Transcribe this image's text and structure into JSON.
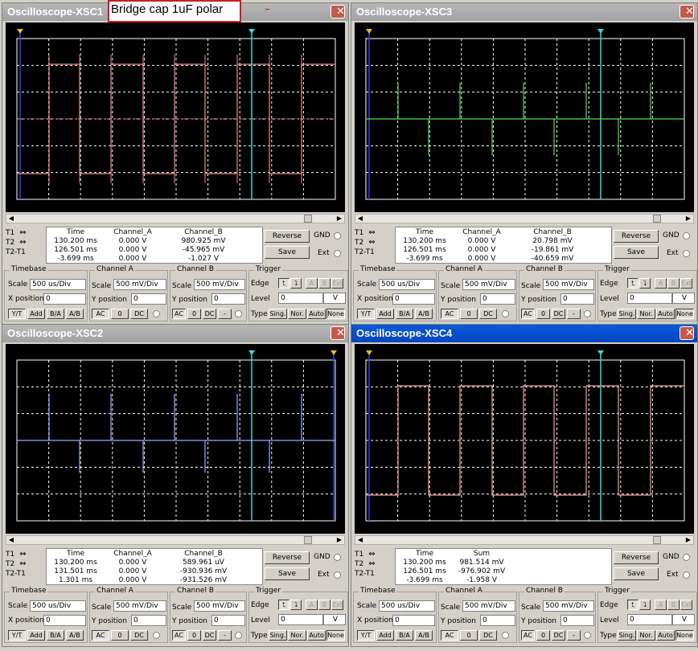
{
  "annotation": "Bridge cap 1uF polar",
  "colors": {
    "ch_a_xsc1": "#f08a8a",
    "ch_a_xsc3": "#4ee04e",
    "ch_a_xsc2": "#9aa8ff",
    "ch_a_xsc4": "#f0a0a0",
    "cursor1": "#3a3ad8",
    "cursor2": "#38d8d8",
    "grid": "#ffffff",
    "titlebar_active": "#0a50d0"
  },
  "icons": {
    "close": "close-icon",
    "cursor_marker": "triangle-marker-icon",
    "radio": "radio-icon",
    "edge_rise": "rising-edge-icon",
    "edge_fall": "falling-edge-icon"
  },
  "scopes": [
    {
      "title": "Oscilloscope-XSC1",
      "active": false,
      "readout": {
        "headers": [
          "Time",
          "Channel_A",
          "Channel_B"
        ],
        "rows": [
          {
            "label": "T1",
            "time": "130.200 ms",
            "a": "0.000 V",
            "b": "980.925 mV"
          },
          {
            "label": "T2",
            "time": "126.501 ms",
            "a": "0.000 V",
            "b": "-45.965 mV"
          },
          {
            "label": "T2-T1",
            "time": "-3.699 ms",
            "a": "0.000 V",
            "b": "-1.027 V"
          }
        ]
      },
      "reverse_label": "Reverse",
      "save_label": "Save",
      "gnd_label": "GND",
      "ext_label": "Ext",
      "timebase": {
        "title": "Timebase",
        "scale_label": "Scale",
        "scale": "500 us/Div",
        "xpos_label": "X position",
        "xpos": "0",
        "modes": [
          "Y/T",
          "Add",
          "B/A",
          "A/B"
        ]
      },
      "chan_a": {
        "title": "Channel A",
        "scale_label": "Scale",
        "scale": "500 mV/Div",
        "ypos_label": "Y position",
        "ypos": "0",
        "coupling": [
          "AC",
          "0",
          "DC"
        ]
      },
      "chan_b": {
        "title": "Channel B",
        "scale_label": "Scale",
        "scale": "500 mV/Div",
        "ypos_label": "Y position",
        "ypos": "0",
        "coupling": [
          "AC",
          "0",
          "DC",
          "-"
        ]
      },
      "trigger": {
        "title": "Trigger",
        "edge_label": "Edge",
        "level_label": "Level",
        "level": "0",
        "unit": "V",
        "type_label": "Type",
        "types": [
          "Sing.",
          "Nor.",
          "Auto",
          "None"
        ],
        "src": [
          "A",
          "B",
          "Ext"
        ]
      }
    },
    {
      "title": "Oscilloscope-XSC3",
      "active": false,
      "readout": {
        "headers": [
          "Time",
          "Channel_A",
          "Channel_B"
        ],
        "rows": [
          {
            "label": "T1",
            "time": "130.200 ms",
            "a": "0.000 V",
            "b": "20.798 mV"
          },
          {
            "label": "T2",
            "time": "126.501 ms",
            "a": "0.000 V",
            "b": "-19.861 mV"
          },
          {
            "label": "T2-T1",
            "time": "-3.699 ms",
            "a": "0.000 V",
            "b": "-40.659 mV"
          }
        ]
      },
      "reverse_label": "Reverse",
      "save_label": "Save",
      "gnd_label": "GND",
      "ext_label": "Ext",
      "timebase": {
        "title": "Timebase",
        "scale_label": "Scale",
        "scale": "500 us/Div",
        "xpos_label": "X position",
        "xpos": "0",
        "modes": [
          "Y/T",
          "Add",
          "B/A",
          "A/B"
        ]
      },
      "chan_a": {
        "title": "Channel A",
        "scale_label": "Scale",
        "scale": "500 mV/Div",
        "ypos_label": "Y position",
        "ypos": "0",
        "coupling": [
          "AC",
          "0",
          "DC"
        ]
      },
      "chan_b": {
        "title": "Channel B",
        "scale_label": "Scale",
        "scale": "500 mV/Div",
        "ypos_label": "Y position",
        "ypos": "0",
        "coupling": [
          "AC",
          "0",
          "DC",
          "-"
        ]
      },
      "trigger": {
        "title": "Trigger",
        "edge_label": "Edge",
        "level_label": "Level",
        "level": "0",
        "unit": "V",
        "type_label": "Type",
        "types": [
          "Sing.",
          "Nor.",
          "Auto",
          "None"
        ],
        "src": [
          "A",
          "B",
          "Ext"
        ]
      }
    },
    {
      "title": "Oscilloscope-XSC2",
      "active": false,
      "readout": {
        "headers": [
          "Time",
          "Channel_A",
          "Channel_B"
        ],
        "rows": [
          {
            "label": "T1",
            "time": "130.200 ms",
            "a": "0.000 V",
            "b": "589.961 uV"
          },
          {
            "label": "T2",
            "time": "131.501 ms",
            "a": "0.000 V",
            "b": "-930.936 mV"
          },
          {
            "label": "T2-T1",
            "time": "1.301 ms",
            "a": "0.000 V",
            "b": "-931.526 mV"
          }
        ]
      },
      "reverse_label": "Reverse",
      "save_label": "Save",
      "gnd_label": "GND",
      "ext_label": "Ext",
      "timebase": {
        "title": "Timebase",
        "scale_label": "Scale",
        "scale": "500 us/Div",
        "xpos_label": "X position",
        "xpos": "0",
        "modes": [
          "Y/T",
          "Add",
          "B/A",
          "A/B"
        ]
      },
      "chan_a": {
        "title": "Channel A",
        "scale_label": "Scale",
        "scale": "500 mV/Div",
        "ypos_label": "Y position",
        "ypos": "0",
        "coupling": [
          "AC",
          "0",
          "DC"
        ]
      },
      "chan_b": {
        "title": "Channel B",
        "scale_label": "Scale",
        "scale": "500 mV/Div",
        "ypos_label": "Y position",
        "ypos": "0",
        "coupling": [
          "AC",
          "0",
          "DC",
          "-"
        ]
      },
      "trigger": {
        "title": "Trigger",
        "edge_label": "Edge",
        "level_label": "Level",
        "level": "0",
        "unit": "V",
        "type_label": "Type",
        "types": [
          "Sing.",
          "Nor.",
          "Auto",
          "None"
        ],
        "src": [
          "A",
          "B",
          "Ext"
        ]
      }
    },
    {
      "title": "Oscilloscope-XSC4",
      "active": true,
      "readout": {
        "headers": [
          "Time",
          "Sum",
          ""
        ],
        "rows": [
          {
            "label": "T1",
            "time": "130.200 ms",
            "a": "981.514 mV",
            "b": ""
          },
          {
            "label": "T2",
            "time": "126.501 ms",
            "a": "-976.902 mV",
            "b": ""
          },
          {
            "label": "T2-T1",
            "time": "-3.699 ms",
            "a": "-1.958 V",
            "b": ""
          }
        ]
      },
      "reverse_label": "Reverse",
      "save_label": "Save",
      "gnd_label": "GND",
      "ext_label": "Ext",
      "timebase": {
        "title": "Timebase",
        "scale_label": "Scale",
        "scale": "500 us/Div",
        "xpos_label": "X position",
        "xpos": "0",
        "modes": [
          "Y/T",
          "Add",
          "B/A",
          "A/B"
        ]
      },
      "chan_a": {
        "title": "Channel A",
        "scale_label": "Scale",
        "scale": "500 mV/Div",
        "ypos_label": "Y position",
        "ypos": "0",
        "coupling": [
          "AC",
          "0",
          "DC"
        ]
      },
      "chan_b": {
        "title": "Channel B",
        "scale_label": "Scale",
        "scale": "500 mV/Div",
        "ypos_label": "Y position",
        "ypos": "0",
        "coupling": [
          "AC",
          "0",
          "DC",
          "-"
        ]
      },
      "trigger": {
        "title": "Trigger",
        "edge_label": "Edge",
        "level_label": "Level",
        "level": "0",
        "unit": "V",
        "type_label": "Type",
        "types": [
          "Sing.",
          "Nor.",
          "Auto",
          "None"
        ],
        "src": [
          "A",
          "B",
          "Ext"
        ]
      }
    }
  ]
}
